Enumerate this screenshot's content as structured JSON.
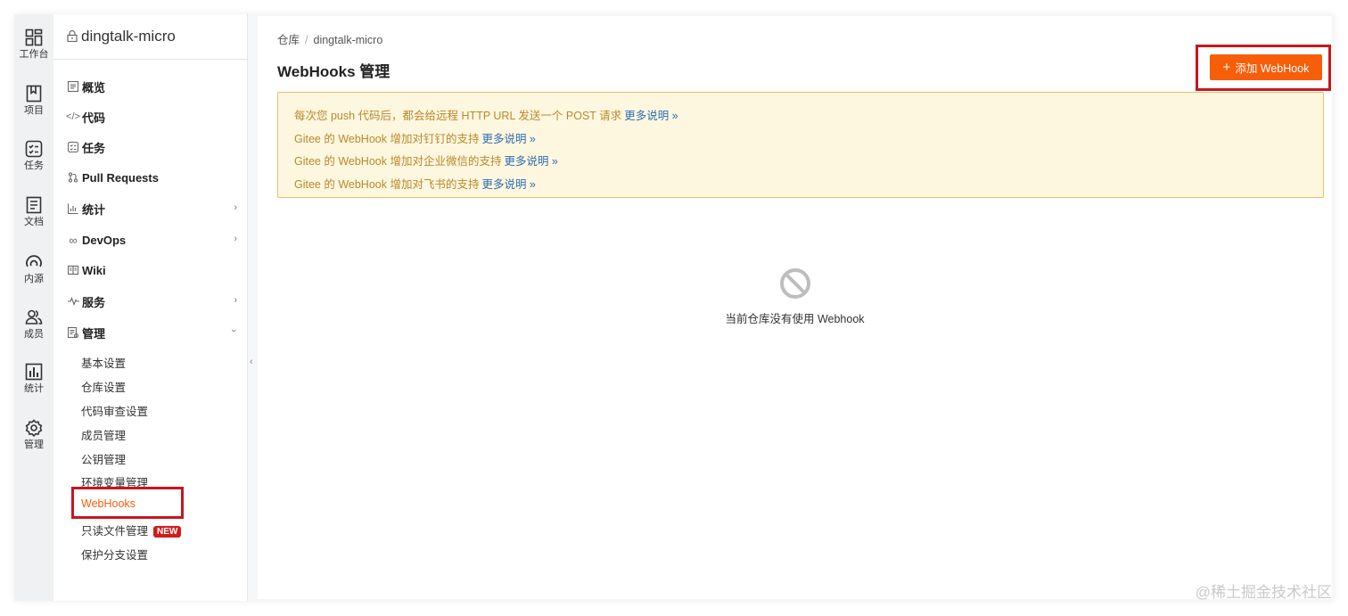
{
  "rail": {
    "items": [
      {
        "label": "工作台",
        "icon": "dashboard-icon"
      },
      {
        "label": "项目",
        "icon": "book-icon"
      },
      {
        "label": "任务",
        "icon": "task-list-icon"
      },
      {
        "label": "文档",
        "icon": "document-icon"
      },
      {
        "label": "内源",
        "icon": "inner-source-icon"
      },
      {
        "label": "成员",
        "icon": "members-icon"
      },
      {
        "label": "统计",
        "icon": "bar-chart-icon"
      },
      {
        "label": "管理",
        "icon": "gear-icon"
      }
    ]
  },
  "sidebar": {
    "repo_name": "dingtalk-micro",
    "nav": [
      {
        "label": "概览",
        "icon": "overview-icon"
      },
      {
        "label": "代码",
        "icon": "code-icon"
      },
      {
        "label": "任务",
        "icon": "task-icon"
      },
      {
        "label": "Pull Requests",
        "icon": "pull-request-icon"
      },
      {
        "label": "统计",
        "icon": "stats-icon"
      },
      {
        "label": "DevOps",
        "icon": "infinity-icon"
      },
      {
        "label": "Wiki",
        "icon": "wiki-icon"
      },
      {
        "label": "服务",
        "icon": "pulse-icon"
      },
      {
        "label": "管理",
        "icon": "manage-icon"
      }
    ],
    "manage_sub": [
      {
        "label": "基本设置"
      },
      {
        "label": "仓库设置"
      },
      {
        "label": "代码审查设置"
      },
      {
        "label": "成员管理"
      },
      {
        "label": "公钥管理"
      },
      {
        "label": "环境变量管理"
      },
      {
        "label": "WebHooks"
      },
      {
        "label": "只读文件管理",
        "badge": "NEW"
      },
      {
        "label": "保护分支设置"
      }
    ],
    "active_sub": "WebHooks"
  },
  "breadcrumb": {
    "root": "仓库",
    "sep": "/",
    "current": "dingtalk-micro"
  },
  "page_title": "WebHooks 管理",
  "add_button": {
    "icon": "+",
    "label": "添加 WebHook"
  },
  "notice": {
    "lines": [
      {
        "text": "每次您 push 代码后，都会给远程 HTTP URL 发送一个 POST 请求",
        "link": "更多说明 »"
      },
      {
        "text": "Gitee 的 WebHook 增加对钉钉的支持",
        "link": "更多说明 »"
      },
      {
        "text": "Gitee 的 WebHook 增加对企业微信的支持",
        "link": "更多说明 »"
      },
      {
        "text": "Gitee 的 WebHook 增加对飞书的支持",
        "link": "更多说明 »"
      }
    ]
  },
  "empty_state": {
    "message": "当前仓库没有使用 Webhook",
    "icon": "forbidden-icon"
  },
  "watermark": "@稀土掘金技术社区",
  "colors": {
    "accent": "#f75e0a",
    "active_text": "#f55d0d",
    "highlight_box": "#c8161d",
    "notice_bg": "#fdf7df",
    "notice_text": "#b9892d",
    "link": "#2f6db5"
  }
}
